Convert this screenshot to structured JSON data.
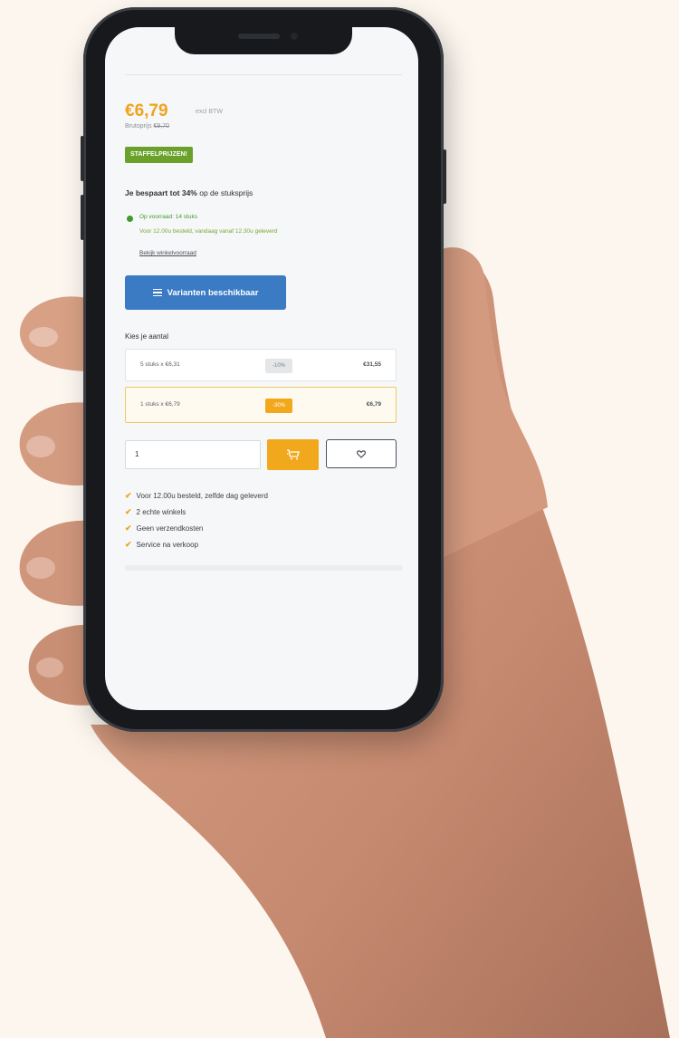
{
  "product": {
    "price": "€6,79",
    "price_unit": "excl BTW",
    "gross_price_label": "Brutoprijs",
    "gross_price_old": "€9,70",
    "badge": "STAFFELPRIJZEN!",
    "saving_prefix": "Je bespaart tot",
    "saving_percent": "34%",
    "saving_suffix": "op de stuksprijs",
    "stock_text": "Op voorraad: 14 stuks",
    "delivery_text": "Voor 12.00u besteld, vandaag vanaf 12.30u geleverd",
    "stock_link": "Bekijk winkelvoorraad",
    "variants_button": "Varianten beschikbaar",
    "quantity_label": "Kies je aantal",
    "tiers": [
      {
        "label": "5 stuks x €6,31",
        "discount": "-10%",
        "total": "€31,55"
      },
      {
        "label": "1 stuks x €6,79",
        "discount": "-30%",
        "total": "€6,79"
      }
    ],
    "quantity_value": "1",
    "cart_icon": "cart-icon",
    "wishlist_icon": "heart-icon",
    "usps": [
      "Voor 12.00u besteld, zelfde dag geleverd",
      "2 echte winkels",
      "Geen verzendkosten",
      "Service na verkoop"
    ]
  },
  "colors": {
    "accent": "#f0a31d",
    "badge_green": "#6aa12a",
    "variant_blue": "#3b7bc4"
  }
}
